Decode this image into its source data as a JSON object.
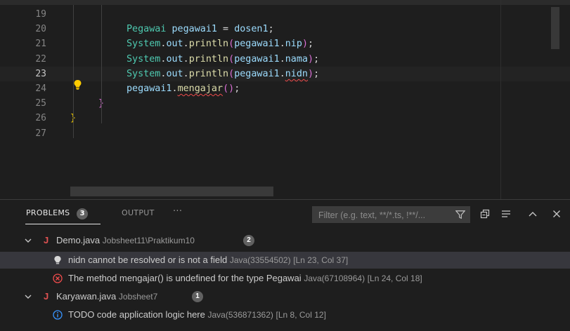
{
  "editor": {
    "lines": [
      {
        "num": "19",
        "code": []
      },
      {
        "num": "20",
        "code": [
          {
            "t": "Pegawai",
            "c": "t-type"
          },
          {
            "t": " ",
            "c": ""
          },
          {
            "t": "pegawai1",
            "c": "t-var"
          },
          {
            "t": " = ",
            "c": "t-pun"
          },
          {
            "t": "dosen1",
            "c": "t-var"
          },
          {
            "t": ";",
            "c": "t-pun"
          }
        ]
      },
      {
        "num": "21",
        "code": [
          {
            "t": "System",
            "c": "t-type"
          },
          {
            "t": ".",
            "c": "t-pun"
          },
          {
            "t": "out",
            "c": "t-var"
          },
          {
            "t": ".",
            "c": "t-pun"
          },
          {
            "t": "println",
            "c": "t-fn"
          },
          {
            "t": "(",
            "c": "t-brace2"
          },
          {
            "t": "pegawai1",
            "c": "t-var"
          },
          {
            "t": ".",
            "c": "t-pun"
          },
          {
            "t": "nip",
            "c": "t-var"
          },
          {
            "t": ")",
            "c": "t-brace2"
          },
          {
            "t": ";",
            "c": "t-pun"
          }
        ]
      },
      {
        "num": "22",
        "code": [
          {
            "t": "System",
            "c": "t-type"
          },
          {
            "t": ".",
            "c": "t-pun"
          },
          {
            "t": "out",
            "c": "t-var"
          },
          {
            "t": ".",
            "c": "t-pun"
          },
          {
            "t": "println",
            "c": "t-fn"
          },
          {
            "t": "(",
            "c": "t-brace2"
          },
          {
            "t": "pegawai1",
            "c": "t-var"
          },
          {
            "t": ".",
            "c": "t-pun"
          },
          {
            "t": "nama",
            "c": "t-var"
          },
          {
            "t": ")",
            "c": "t-brace2"
          },
          {
            "t": ";",
            "c": "t-pun"
          }
        ]
      },
      {
        "num": "23",
        "active": true,
        "code": [
          {
            "t": "System",
            "c": "t-type"
          },
          {
            "t": ".",
            "c": "t-pun"
          },
          {
            "t": "out",
            "c": "t-var"
          },
          {
            "t": ".",
            "c": "t-pun"
          },
          {
            "t": "println",
            "c": "t-fn"
          },
          {
            "t": "(",
            "c": "t-brace2"
          },
          {
            "t": "pegawai1",
            "c": "t-var"
          },
          {
            "t": ".",
            "c": "t-pun"
          },
          {
            "t": "nidn",
            "c": "t-var squig"
          },
          {
            "t": ")",
            "c": "t-brace2"
          },
          {
            "t": ";",
            "c": "t-pun"
          }
        ]
      },
      {
        "num": "24",
        "code": [
          {
            "t": "pegawai1",
            "c": "t-var"
          },
          {
            "t": ".",
            "c": "t-pun"
          },
          {
            "t": "mengajar",
            "c": "t-fn squig"
          },
          {
            "t": "()",
            "c": "t-brace2"
          },
          {
            "t": ";",
            "c": "t-pun"
          }
        ]
      },
      {
        "num": "25",
        "code": [
          {
            "t": "}",
            "c": "t-brace2"
          }
        ],
        "indent": 40
      },
      {
        "num": "26",
        "code": [
          {
            "t": "}",
            "c": "t-brace"
          }
        ],
        "indent": 0
      },
      {
        "num": "27",
        "code": []
      }
    ]
  },
  "panel": {
    "tabs": {
      "problems": "PROBLEMS",
      "problems_count": "3",
      "output": "OUTPUT",
      "more": "···"
    },
    "filter_placeholder": "Filter (e.g. text, **/*.ts, !**/...",
    "groups": [
      {
        "file": "Demo.java",
        "path": "Jobsheet11\\Praktikum10",
        "count": "2",
        "items": [
          {
            "kind": "warning",
            "message": "nidn cannot be resolved or is not a field",
            "source": "Java(33554502)",
            "loc": "[Ln 23, Col 37]"
          },
          {
            "kind": "error",
            "message": "The method mengajar() is undefined for the type Pegawai",
            "source": "Java(67108964)",
            "loc": "[Ln 24, Col 18]"
          }
        ]
      },
      {
        "file": "Karyawan.java",
        "path": "Jobsheet7",
        "count": "1",
        "items": [
          {
            "kind": "info",
            "message": "TODO code application logic here",
            "source": "Java(536871362)",
            "loc": "[Ln 8, Col 12]"
          }
        ]
      }
    ]
  },
  "colors": {
    "error": "#f14c4c",
    "info": "#3794ff",
    "warning_bulb": "#ffcc00",
    "java_icon": "#e05252"
  }
}
